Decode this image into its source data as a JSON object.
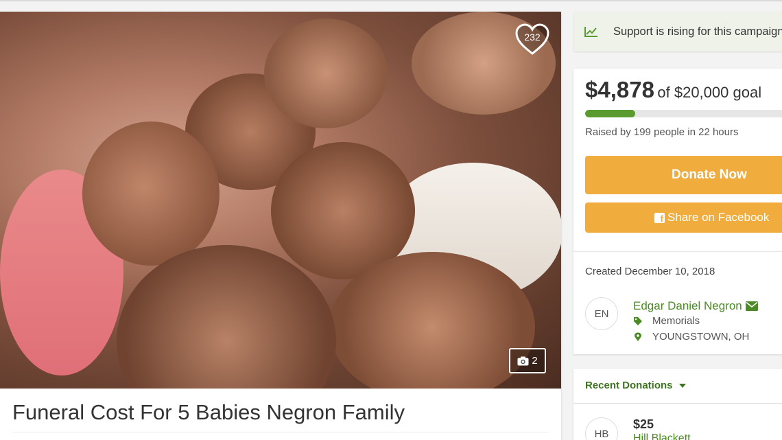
{
  "campaign": {
    "title": "Funeral Cost For 5 Babies Negron Family",
    "hearts": "232",
    "photo_count": "2",
    "photo_alt": "Photo of five children"
  },
  "rising": {
    "text": "Support is rising for this campaign"
  },
  "stats": {
    "amount": "$4,878",
    "goal": "of $20,000 goal",
    "progress": 0.2439,
    "raised_text": "Raised by 199 people in 22 hours",
    "donate_label": "Donate Now",
    "share_label": "Share on Facebook"
  },
  "info": {
    "created": "Created December 10, 2018",
    "organizer_initials": "EN",
    "organizer_name": "Edgar Daniel Negron",
    "category": "Memorials",
    "location": "YOUNGSTOWN, OH"
  },
  "donations": {
    "header": "Recent Donations",
    "items": [
      {
        "initials": "HB",
        "amount": "$25",
        "name": "Hill Blackett"
      }
    ]
  },
  "colors": {
    "accent_green": "#4b8a24",
    "button_orange": "#f0ad3e",
    "progress_green": "#5a9b2f"
  },
  "icons": {
    "rising": "trend-up-icon",
    "heart": "heart-icon",
    "camera": "camera-icon",
    "facebook": "facebook-icon",
    "email": "envelope-icon",
    "category": "tag-icon",
    "location": "map-pin-icon"
  }
}
